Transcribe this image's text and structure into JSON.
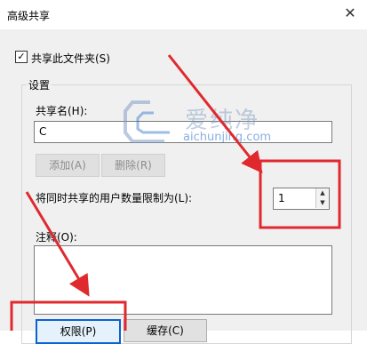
{
  "window": {
    "title": "高级共享",
    "close_glyph": "✕"
  },
  "share_checkbox": {
    "checked": true,
    "label": "共享此文件夹(S)",
    "check_glyph": "✓"
  },
  "settings": {
    "group_title": "设置",
    "share_name_label": "共享名(H):",
    "share_name_value": "C",
    "add_button": "添加(A)",
    "remove_button": "删除(R)",
    "limit_label": "将同时共享的用户数量限制为(L):",
    "limit_value": "1",
    "comment_label": "注释(O):",
    "comment_value": ""
  },
  "buttons": {
    "permissions": "权限(P)",
    "caching": "缓存(C)"
  },
  "watermark": {
    "text": "爱纯净",
    "url": "aichunjing.com"
  },
  "annotation_color": "#e0292e",
  "icons": {
    "close": "close-icon",
    "checkbox": "checkmark-icon",
    "spin_up": "spin-up-icon",
    "spin_down": "spin-down-icon",
    "logo": "aichunjing-logo"
  }
}
